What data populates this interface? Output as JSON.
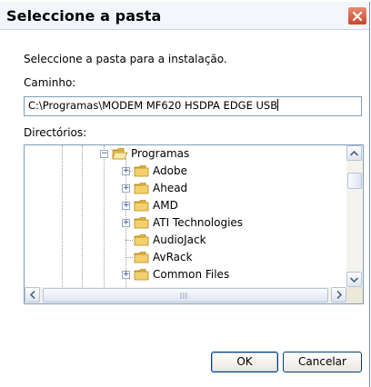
{
  "dialog": {
    "title": "Seleccione a pasta",
    "instruction": "Seleccione a pasta para a instalação.",
    "path_label": "Caminho:",
    "path_value": "C:\\Programas\\MODEM MF620 HSDPA EDGE USB",
    "dirs_label": "Directórios:",
    "ok_label": "OK",
    "cancel_label": "Cancelar"
  },
  "tree": {
    "root": {
      "label": "Programas",
      "expanded": true
    },
    "children": [
      {
        "label": "Adobe",
        "expandable": true
      },
      {
        "label": "Ahead",
        "expandable": true
      },
      {
        "label": "AMD",
        "expandable": true
      },
      {
        "label": "ATI Technologies",
        "expandable": true
      },
      {
        "label": "AudioJack",
        "expandable": false
      },
      {
        "label": "AvRack",
        "expandable": false
      },
      {
        "label": "Common Files",
        "expandable": true
      }
    ]
  },
  "icons": {
    "close": "close-icon",
    "folder": "folder-icon",
    "scroll_up": "arrow-up-icon",
    "scroll_down": "arrow-down-icon",
    "scroll_left": "arrow-left-icon",
    "scroll_right": "arrow-right-icon"
  },
  "colors": {
    "close_button": "#c8452b",
    "folder": "#f3d06b",
    "input_border": "#7f9db9",
    "button_border": "#003c74"
  }
}
